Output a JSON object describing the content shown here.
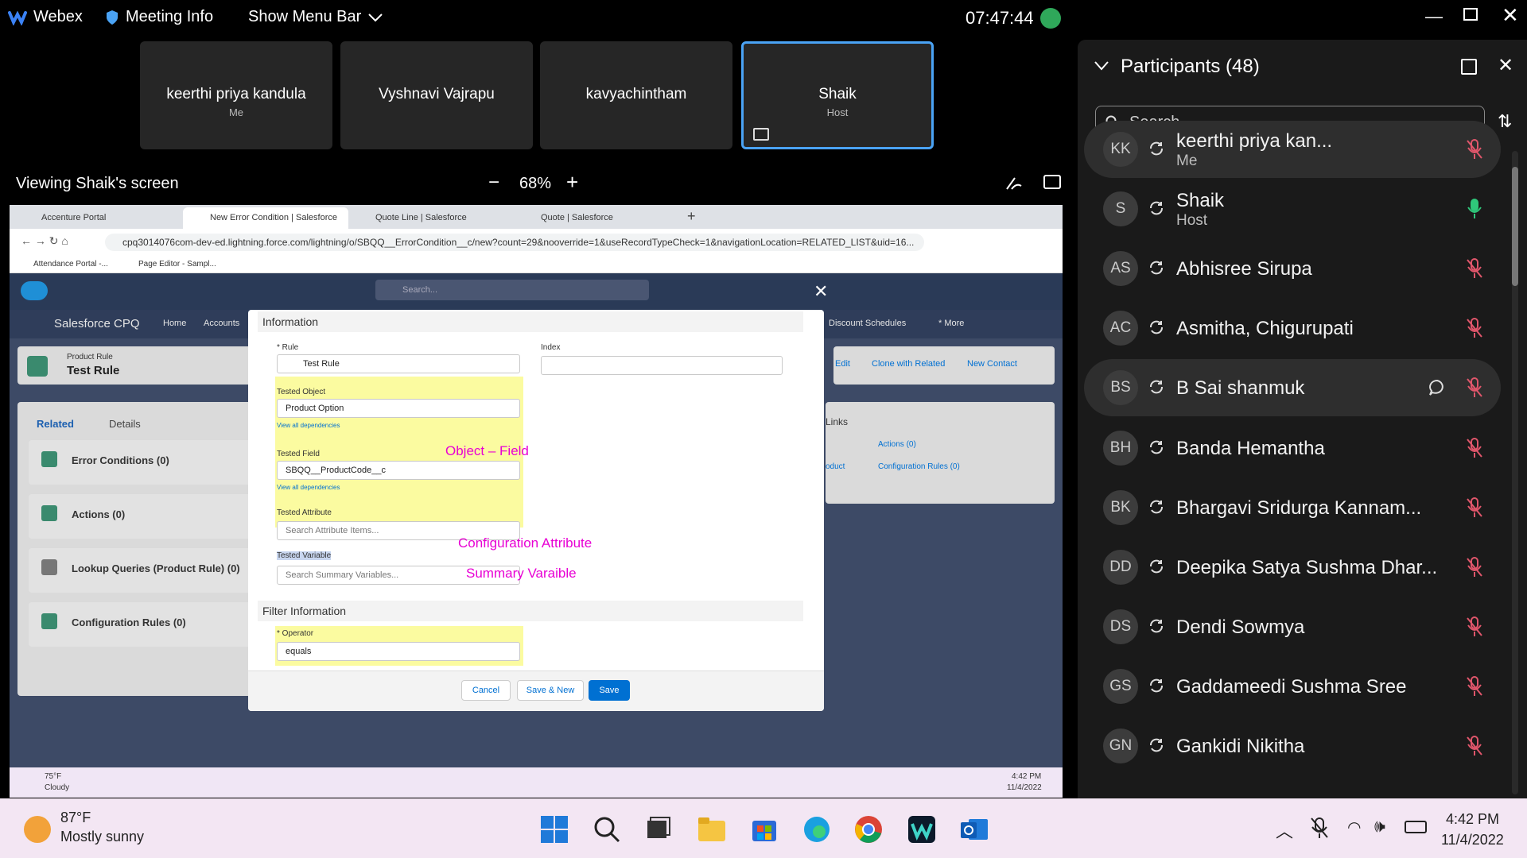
{
  "topbar": {
    "app": "Webex",
    "meeting_info": "Meeting Info",
    "show_menu": "Show Menu Bar",
    "clock": "07:47:44"
  },
  "tiles": [
    {
      "name": "keerthi priya kandula",
      "sub": "Me"
    },
    {
      "name": "Vyshnavi Vajrapu",
      "sub": ""
    },
    {
      "name": "kavyachintham",
      "sub": ""
    },
    {
      "name": "Shaik",
      "sub": "Host"
    }
  ],
  "viewing": {
    "label": "Viewing Shaik's screen",
    "zoom": "68%",
    "minus": "−",
    "plus": "+"
  },
  "browser": {
    "tabs": [
      "Accenture Portal",
      "New Error Condition | Salesforce",
      "Quote Line | Salesforce",
      "Quote | Salesforce"
    ],
    "url": "cpq3014076com-dev-ed.lightning.force.com/lightning/o/SBQQ__ErrorCondition__c/new?count=29&nooverride=1&useRecordTypeCheck=1&navigationLocation=RELATED_LIST&uid=16...",
    "bookmarks": [
      "Attendance Portal -...",
      "Page Editor - Sampl..."
    ]
  },
  "sf": {
    "search": "Search...",
    "app_name": "Salesforce CPQ",
    "nav": [
      "Home",
      "Accounts",
      "Discount Schedules",
      "* More"
    ],
    "record_type": "Product Rule",
    "record_name": "Test Rule",
    "tabs": [
      "Related",
      "Details"
    ],
    "related": [
      "Error Conditions (0)",
      "Actions (0)",
      "Lookup Queries (Product Rule) (0)",
      "Configuration Rules (0)"
    ],
    "right_buttons": [
      "Edit",
      "Clone with Related",
      "New Contact"
    ],
    "links_title": "Links",
    "links": [
      "Actions (0)",
      "Configuration Rules (0)"
    ],
    "links_prefix": "oduct"
  },
  "modal": {
    "section_info": "Information",
    "rule_label": "* Rule",
    "rule_value": "Test Rule",
    "index_label": "Index",
    "tested_object_label": "Tested Object",
    "tested_object_value": "Product Option",
    "view_deps": "View all dependencies",
    "tested_field_label": "Tested Field",
    "tested_field_value": "SBQQ__ProductCode__c",
    "tested_attribute_label": "Tested Attribute",
    "tested_attribute_placeholder": "Search Attribute Items...",
    "tested_variable_label": "Tested Variable",
    "tested_variable_placeholder": "Search Summary Variables...",
    "section_filter": "Filter Information",
    "operator_label": "* Operator",
    "operator_value": "equals",
    "cancel": "Cancel",
    "save_new": "Save & New",
    "save": "Save"
  },
  "annotations": {
    "a1": "Object – Field",
    "a2": "Configuration Attribute",
    "a3": "Summary Varaible"
  },
  "inner_taskbar": {
    "temp": "75°F",
    "cond": "Cloudy",
    "time": "4:42 PM",
    "date": "11/4/2022"
  },
  "panel": {
    "title": "Participants (48)",
    "search": "Search",
    "participants": [
      {
        "initials": "KK",
        "name": "keerthi priya kan...",
        "sub": "Me",
        "mic": "muted"
      },
      {
        "initials": "S",
        "name": "Shaik",
        "sub": "Host",
        "mic": "on"
      },
      {
        "initials": "AS",
        "name": "Abhisree Sirupa",
        "sub": "",
        "mic": "muted"
      },
      {
        "initials": "AC",
        "name": "Asmitha, Chigurupati",
        "sub": "",
        "mic": "muted"
      },
      {
        "initials": "BS",
        "name": "B Sai shanmuk",
        "sub": "",
        "mic": "muted"
      },
      {
        "initials": "BH",
        "name": "Banda Hemantha",
        "sub": "",
        "mic": "muted"
      },
      {
        "initials": "BK",
        "name": "Bhargavi Sridurga Kannam...",
        "sub": "",
        "mic": "muted"
      },
      {
        "initials": "DD",
        "name": "Deepika Satya Sushma Dhar...",
        "sub": "",
        "mic": "muted"
      },
      {
        "initials": "DS",
        "name": "Dendi Sowmya",
        "sub": "",
        "mic": "muted"
      },
      {
        "initials": "GS",
        "name": "Gaddameedi Sushma Sree",
        "sub": "",
        "mic": "muted"
      },
      {
        "initials": "GN",
        "name": "Gankidi Nikitha",
        "sub": "",
        "mic": "muted"
      }
    ]
  },
  "taskbar": {
    "temp": "87°F",
    "cond": "Mostly sunny",
    "time": "4:42 PM",
    "date": "11/4/2022"
  },
  "colors": {
    "accent": "#4aa3f5",
    "annotation": "#e800d4",
    "muted_mic": "#e0566b",
    "on_mic": "#2fc77a",
    "sf_blue": "#0070d2"
  }
}
